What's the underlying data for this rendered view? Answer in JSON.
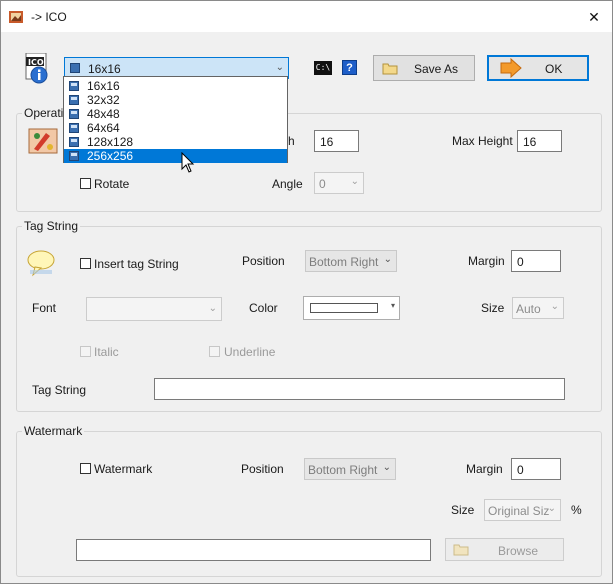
{
  "window": {
    "title": "-> ICO",
    "close_glyph": "✕"
  },
  "toolbar": {
    "format_selected": "16x16",
    "save_as_label": "Save As",
    "ok_label": "OK",
    "ico_badge": "ICO",
    "help_label": "?",
    "console_label": "C:\\"
  },
  "size_dropdown": {
    "options": [
      "16x16",
      "32x32",
      "48x48",
      "64x64",
      "128x128",
      "256x256"
    ],
    "selected_index": 5
  },
  "operation": {
    "legend": "Operatio",
    "width_label_fragment": "h",
    "width_value": "16",
    "max_height_label": "Max Height",
    "max_height_value": "16",
    "rotate_label": "Rotate",
    "angle_label": "Angle",
    "angle_value": "0"
  },
  "tag_string": {
    "legend": "Tag String",
    "insert_label": "Insert tag String",
    "position_label": "Position",
    "position_value": "Bottom Right",
    "margin_label": "Margin",
    "margin_value": "0",
    "font_label": "Font",
    "color_label": "Color",
    "size_label": "Size",
    "size_value": "Auto",
    "italic_label": "Italic",
    "underline_label": "Underline",
    "tag_string_label": "Tag String"
  },
  "watermark": {
    "legend": "Watermark",
    "checkbox_label": "Watermark",
    "position_label": "Position",
    "position_value": "Bottom Right",
    "margin_label": "Margin",
    "margin_value": "0",
    "size_label": "Size",
    "size_value": "Original Siz",
    "percent_label": "%",
    "browse_label": "Browse"
  }
}
